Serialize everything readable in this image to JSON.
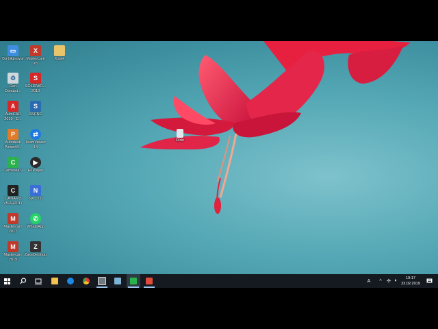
{
  "desktop": {
    "icons": [
      {
        "label": "Bu bilgisayar",
        "icon": "computer-icon",
        "color": "#3d8ee0",
        "glyph": "▭"
      },
      {
        "label": "Mastercam\nX5",
        "icon": "mastercam-x5-icon",
        "color": "#c0392b",
        "glyph": "X"
      },
      {
        "label": "Kişisk",
        "icon": "folder-icon",
        "color": "#e9c46a",
        "glyph": ""
      },
      {
        "label": "Geri\nDönüşü...",
        "icon": "recycle-bin-icon",
        "color": "#cfd8dc",
        "glyph": "♻"
      },
      {
        "label": "SOLIDWO...\n2019",
        "icon": "solidworks-icon",
        "color": "#d62828",
        "glyph": "S"
      },
      {
        "label": "AutoCAD\n2019 - E...",
        "icon": "autocad-icon",
        "color": "#d62828",
        "glyph": "A"
      },
      {
        "label": "SSCNC",
        "icon": "sscnc-icon",
        "color": "#2b6cb0",
        "glyph": "S"
      },
      {
        "label": "Autodesk\nPowerM...",
        "icon": "powermill-icon",
        "color": "#e07b2a",
        "glyph": "P"
      },
      {
        "label": "TeamViewer\n14",
        "icon": "teamviewer-icon",
        "color": "#1f7ae0",
        "glyph": "⇄"
      },
      {
        "label": "Camtasia 9",
        "icon": "camtasia-icon",
        "color": "#2bb24c",
        "glyph": "C"
      },
      {
        "label": "HLPlayer",
        "icon": "hlplayer-icon",
        "color": "#2a2a2a",
        "glyph": "▶"
      },
      {
        "label": "CATIA P3\nV5-6R2017",
        "icon": "catia-icon",
        "color": "#222222",
        "glyph": "C"
      },
      {
        "label": "NX 12.0",
        "icon": "nx-icon",
        "color": "#3a6fd8",
        "glyph": "N"
      },
      {
        "label": "Mastercam\n2017",
        "icon": "mastercam-2017-icon",
        "color": "#c0392b",
        "glyph": "M"
      },
      {
        "label": "WhatsApp",
        "icon": "whatsapp-icon",
        "color": "#25d366",
        "glyph": "✆"
      },
      {
        "label": "Mastercam\n2019",
        "icon": "mastercam-2019-icon",
        "color": "#c0392b",
        "glyph": "M"
      },
      {
        "label": "ZaxeDesktop",
        "icon": "zaxedesktop-icon",
        "color": "#333333",
        "glyph": "Z"
      },
      {
        "label": "Dizin",
        "icon": "file-icon",
        "color": "#dfe6ec",
        "glyph": ""
      }
    ]
  },
  "taskbar": {
    "start_icon": "windows-start-icon",
    "search_icon": "search-icon",
    "taskview_icon": "task-view-icon",
    "apps": [
      {
        "icon": "file-explorer-icon",
        "color": "#f2c14e",
        "active": false
      },
      {
        "icon": "edge-icon",
        "color": "#1e88e5",
        "active": false
      },
      {
        "icon": "chrome-icon",
        "color": "#e53935",
        "active": false
      },
      {
        "icon": "media-app-icon",
        "color": "#707880",
        "active": true
      },
      {
        "icon": "notepad-icon",
        "color": "#7fb3d5",
        "active": false
      },
      {
        "icon": "camtasia-taskbar-icon",
        "color": "#2bb24c",
        "active": true
      },
      {
        "icon": "camtasia-recorder-icon",
        "color": "#e04b3a",
        "active": true
      }
    ],
    "tray": {
      "ime": "A",
      "chevron": "^",
      "clock_time": "19:17",
      "clock_date": "23.02.2019"
    }
  }
}
